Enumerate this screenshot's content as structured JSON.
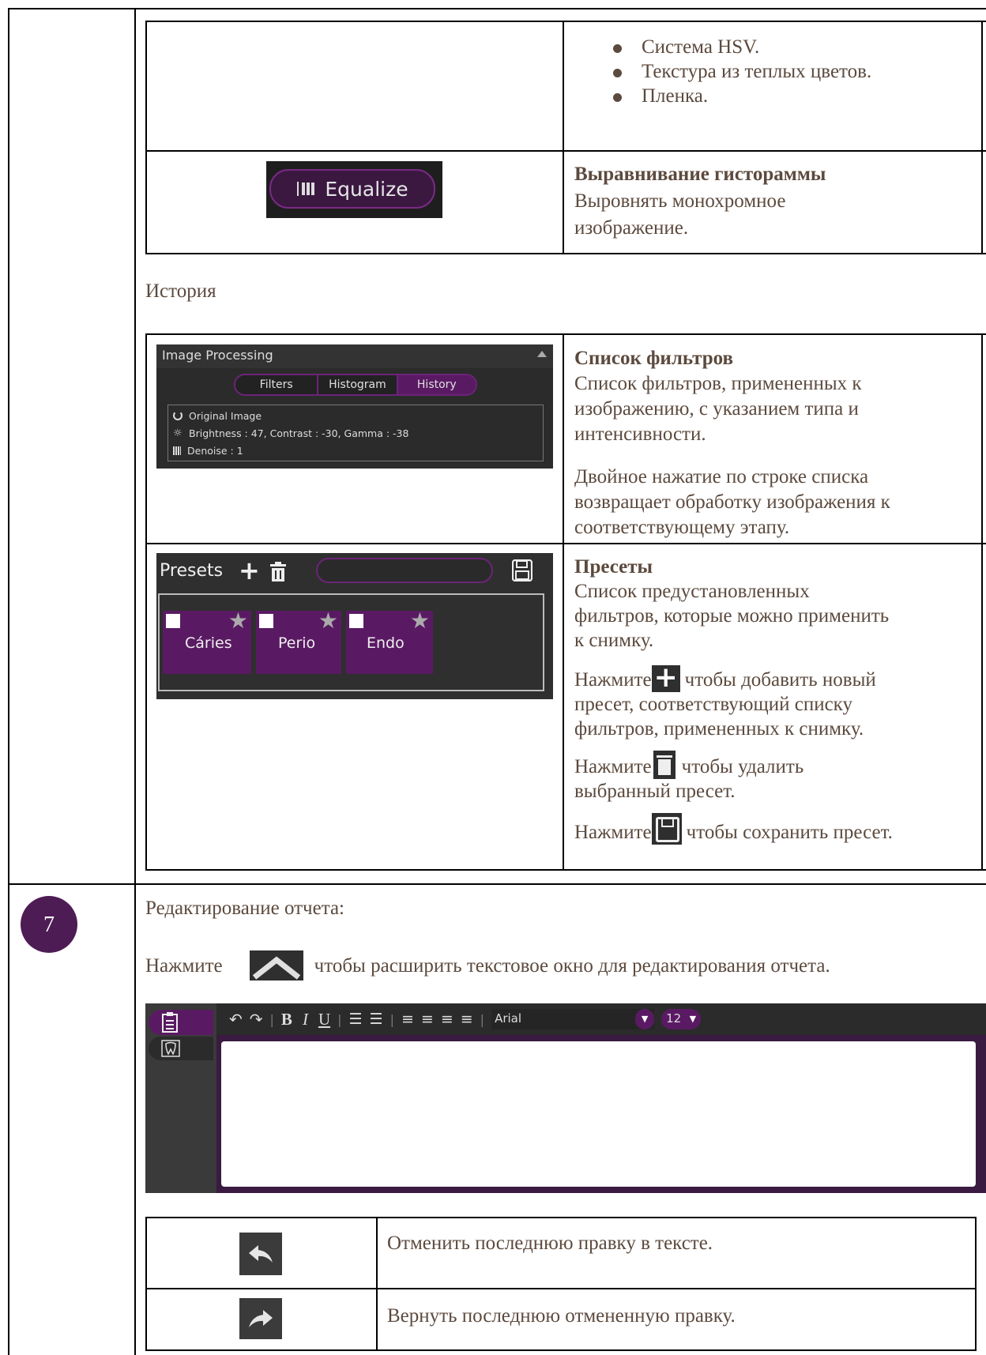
{
  "row1": {
    "bullets": [
      "Система HSV.",
      "Текстура из теплых цветов.",
      "Пленка."
    ]
  },
  "equalize": {
    "button_label": "Equalize",
    "title": "Выравнивание гисторам",
    "title_tail": "мы",
    "desc_line1": "Выровнять монохромное",
    "desc_line2": "изображение."
  },
  "history_heading": "История",
  "image_processing": {
    "panel_title": "Image Processing",
    "tabs": [
      "Filters",
      "Histogram",
      "History"
    ],
    "active_tab": "History",
    "history_items": [
      {
        "icon": "reset-icon",
        "text": "Original Image"
      },
      {
        "icon": "brightness-icon",
        "text": "Brightness : 47, Contrast : -30, Gamma : -38"
      },
      {
        "icon": "denoise-icon",
        "text": "Denoise : 1"
      }
    ],
    "title": "Список фильтров",
    "desc_line1": "Список фильтров, примененных к",
    "desc_line2": "изображению, с указанием типа и",
    "desc_line3": "интенсивности.",
    "desc2_line1": "Двойное нажатие по строке списка",
    "desc2_line2": "возвращает обработку изображения к",
    "desc2_line3": "соответствующему этапу."
  },
  "presets": {
    "panel_label": "Presets",
    "search_value": "",
    "cards": [
      "Cáries",
      "Perio",
      "Endo"
    ],
    "title": "Пресеты",
    "desc_line1": "Список предустановленных",
    "desc_line2": "фильтров, которые можно применить",
    "desc_line3": "к снимку.",
    "add_prefix": "Нажмите",
    "add_line1": "чтобы добавить новый",
    "add_line2": "пресет, соответствующий списку",
    "add_line3": "фильтров, примененных к снимку.",
    "del_prefix": "Нажмите",
    "del_line1": "чтобы удалить",
    "del_line2": "выбранный пресет.",
    "save_prefix": "Нажмите",
    "save_line1": "чтобы сохранить пресет."
  },
  "step7": {
    "number": "7",
    "heading": "Редактирование отчета:",
    "expand_prefix": "Нажмите",
    "expand_text": "чтобы расширить текстовое окно для редактирования отчета.",
    "font_name": "Arial",
    "font_size": "12"
  },
  "edit_table": {
    "undo_desc": "Отменить последнюю правку в тексте.",
    "redo_desc": "Вернуть последнюю отмененную правку."
  },
  "colors": {
    "text": "#5c4a3e",
    "purple": "#5a1a63",
    "dark_panel": "#2b2b2b",
    "step_circle": "#4e1c55"
  }
}
